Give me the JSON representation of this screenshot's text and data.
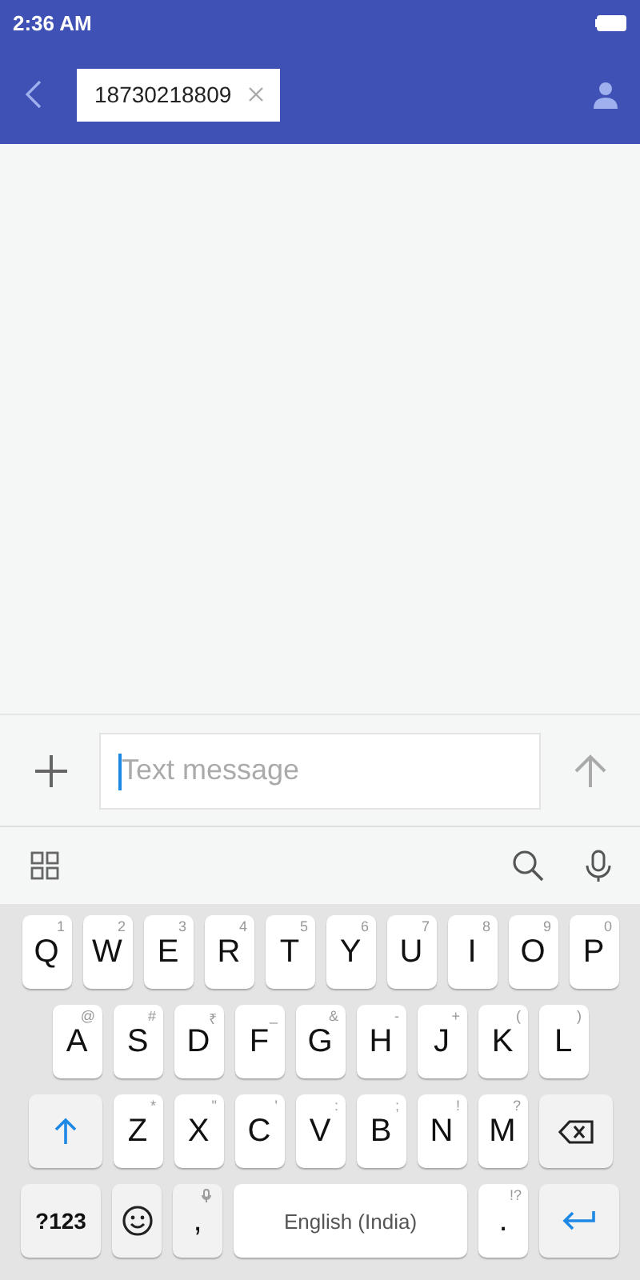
{
  "status_bar": {
    "time": "2:36 AM"
  },
  "header": {
    "recipient": "18730218809"
  },
  "composer": {
    "placeholder": "Text message"
  },
  "keyboard": {
    "top_row": [
      {
        "kind": "letter",
        "label": "Q",
        "hint": "1"
      },
      {
        "kind": "letter",
        "label": "W",
        "hint": "2"
      },
      {
        "kind": "letter",
        "label": "E",
        "hint": "3"
      },
      {
        "kind": "letter",
        "label": "R",
        "hint": "4"
      },
      {
        "kind": "letter",
        "label": "T",
        "hint": "5"
      },
      {
        "kind": "letter",
        "label": "Y",
        "hint": "6"
      },
      {
        "kind": "letter",
        "label": "U",
        "hint": "7"
      },
      {
        "kind": "letter",
        "label": "I",
        "hint": "8"
      },
      {
        "kind": "letter",
        "label": "O",
        "hint": "9"
      },
      {
        "kind": "letter",
        "label": "P",
        "hint": "0"
      }
    ],
    "middle_row": [
      {
        "kind": "letter",
        "label": "A",
        "hint": "@"
      },
      {
        "kind": "letter",
        "label": "S",
        "hint": "#"
      },
      {
        "kind": "letter",
        "label": "D",
        "hint": "₹"
      },
      {
        "kind": "letter",
        "label": "F",
        "hint": "_"
      },
      {
        "kind": "letter",
        "label": "G",
        "hint": "&"
      },
      {
        "kind": "letter",
        "label": "H",
        "hint": "-"
      },
      {
        "kind": "letter",
        "label": "J",
        "hint": "+"
      },
      {
        "kind": "letter",
        "label": "K",
        "hint": "("
      },
      {
        "kind": "letter",
        "label": "L",
        "hint": ")"
      }
    ],
    "bottom_row": [
      {
        "kind": "shift"
      },
      {
        "kind": "letter",
        "label": "Z",
        "hint": "*"
      },
      {
        "kind": "letter",
        "label": "X",
        "hint": "\""
      },
      {
        "kind": "letter",
        "label": "C",
        "hint": "'"
      },
      {
        "kind": "letter",
        "label": "V",
        "hint": ":"
      },
      {
        "kind": "letter",
        "label": "B",
        "hint": ";"
      },
      {
        "kind": "letter",
        "label": "N",
        "hint": "!"
      },
      {
        "kind": "letter",
        "label": "M",
        "hint": "?"
      },
      {
        "kind": "backspace"
      }
    ],
    "space_row": [
      {
        "kind": "symbols",
        "label": "?123"
      },
      {
        "kind": "emoji"
      },
      {
        "kind": "comma",
        "label": ","
      },
      {
        "kind": "space",
        "label": "English (India)"
      },
      {
        "kind": "letter",
        "label": ".",
        "hint": "!?"
      },
      {
        "kind": "enter"
      }
    ]
  }
}
